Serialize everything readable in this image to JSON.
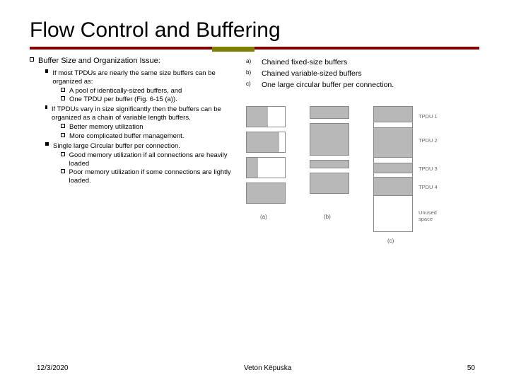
{
  "title": "Flow Control and Buffering",
  "section_heading": "Buffer Size and Organization Issue:",
  "bullets": [
    {
      "text": "If most TPDUs are nearly the same size buffers can be organized as:",
      "sub": [
        {
          "text": "A pool of identically-sized buffers, and"
        },
        {
          "text": "One TPDU per buffer (Fig. 6-15 (a))."
        }
      ]
    },
    {
      "text": "If TPDUs vary in size significantly then the buffers can be organized as a chain of variable length buffers.",
      "sub": [
        {
          "text": "Better memory utilization"
        },
        {
          "text": "More complicated buffer management."
        }
      ]
    },
    {
      "text": "Single large Circular buffer per connection.",
      "sub": [
        {
          "text": "Good memory utilization if all connections are heavily loaded"
        },
        {
          "text": "Poor memory utilization if some connections are lightly loaded."
        }
      ]
    }
  ],
  "legend": [
    {
      "label": "a)",
      "text": "Chained fixed-size buffers"
    },
    {
      "label": "b)",
      "text": "Chained variable-sized buffers"
    },
    {
      "label": "c)",
      "text": "One large circular buffer per connection."
    }
  ],
  "figure": {
    "col_labels": [
      "(a)",
      "(b)",
      "(c)"
    ],
    "row_labels": [
      "TPDU 1",
      "TPDU 2",
      "TPDU 3",
      "TPDU 4"
    ],
    "unused_label": "Unused space"
  },
  "footer": {
    "date": "12/3/2020",
    "author": "Veton Këpuska",
    "page": "50"
  }
}
